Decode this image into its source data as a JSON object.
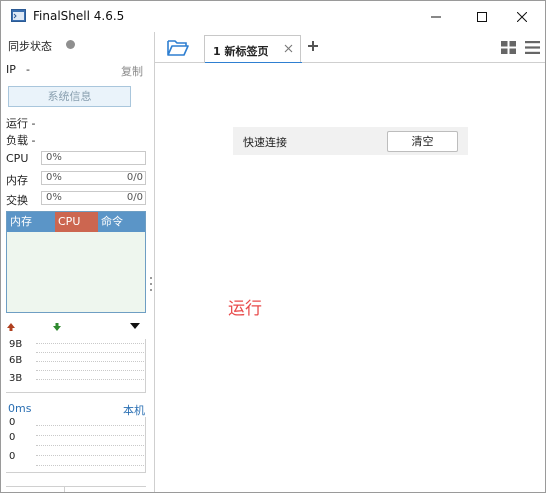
{
  "window": {
    "title": "FinalShell 4.6.5"
  },
  "sidebar": {
    "sync_label": "同步状态",
    "ip_label": "IP",
    "ip_value": "-",
    "copy_label": "复制",
    "sysinfo_button": "系统信息",
    "run_label": "运行 -",
    "load_label": "负载 -",
    "metrics": [
      {
        "label": "CPU",
        "value": "0%",
        "extra": ""
      },
      {
        "label": "内存",
        "value": "0%",
        "extra": "0/0"
      },
      {
        "label": "交换",
        "value": "0%",
        "extra": "0/0"
      }
    ],
    "process_table": {
      "columns": [
        "内存",
        "CPU",
        "命令"
      ],
      "rows": []
    },
    "network": {
      "ticks": [
        "9B",
        "6B",
        "3B"
      ]
    },
    "ping": {
      "label": "0ms",
      "host": "本机",
      "ticks": [
        "0",
        "0",
        "0"
      ]
    }
  },
  "tabs": [
    {
      "label": "1 新标签页",
      "active": true
    }
  ],
  "quick_connect": {
    "label": "快速连接",
    "clear_button": "清空"
  },
  "status_text": "运行",
  "colors": {
    "accent": "#2e7fd1",
    "table_header": "#5b95c7",
    "cpu_header": "#cc6650",
    "run_text": "#e84b4b"
  },
  "icons": {
    "app": "finalshell-icon",
    "folder": "folder-open-icon",
    "add_tab": "plus-icon",
    "grid_view": "grid-view-icon",
    "list_view": "menu-icon",
    "net_up": "arrow-up-icon",
    "net_down": "arrow-down-icon",
    "dropdown": "triangle-down-icon"
  }
}
